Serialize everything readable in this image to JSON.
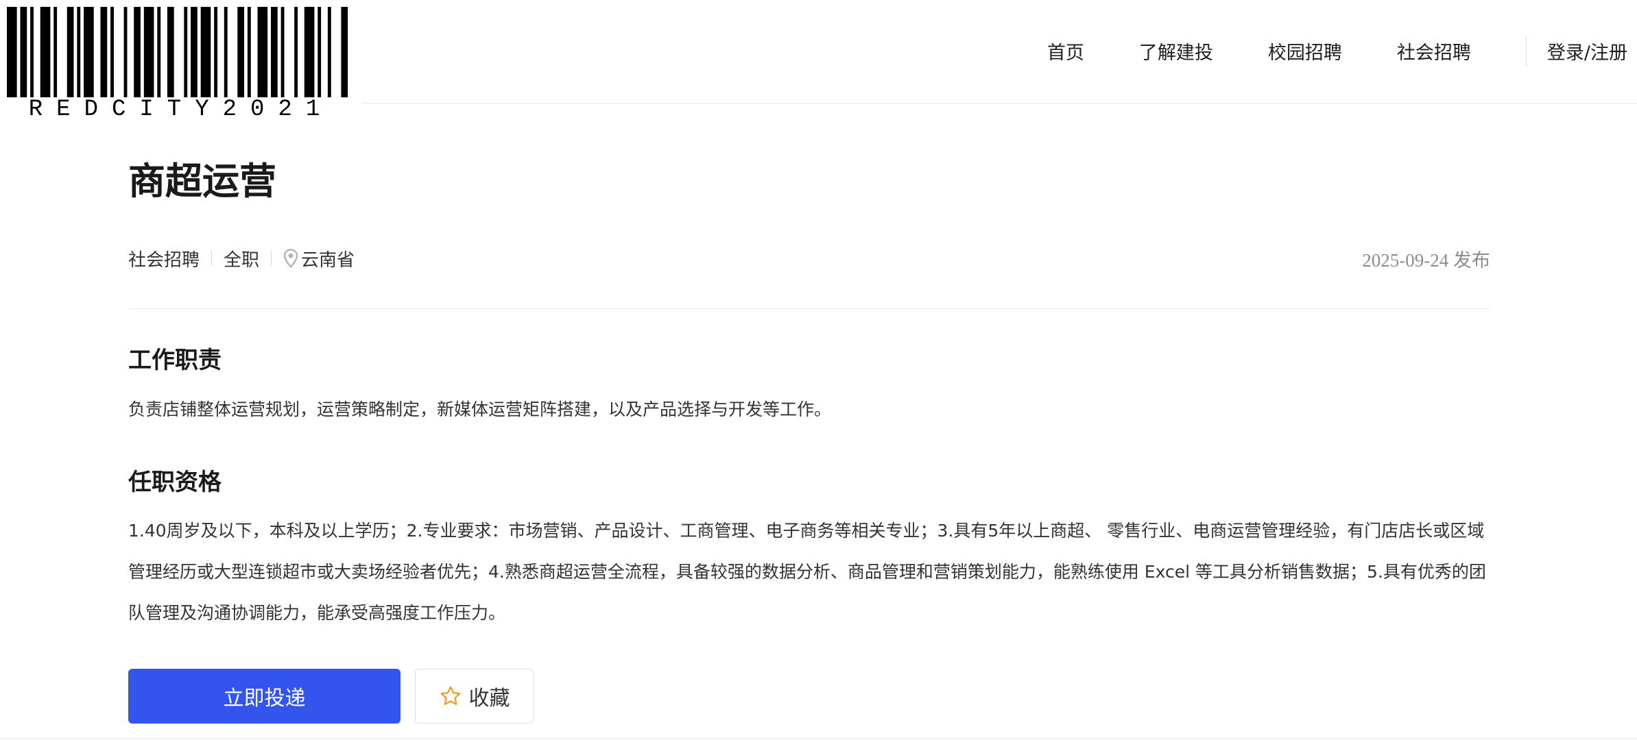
{
  "logo": {
    "barcode_text": "REDCITY2021"
  },
  "nav": {
    "home": "首页",
    "about": "了解建投",
    "campus": "校园招聘",
    "social": "社会招聘",
    "login": "登录/注册"
  },
  "job": {
    "title": "商超运营",
    "category": "社会招聘",
    "type": "全职",
    "location": "云南省",
    "published": "2025-09-24 发布"
  },
  "sections": {
    "duties_heading": "工作职责",
    "duties_text": "负责店铺整体运营规划，运营策略制定，新媒体运营矩阵搭建，以及产品选择与开发等工作。",
    "qualifications_heading": "任职资格",
    "qualifications_text": "1.40周岁及以下，本科及以上学历；2.专业要求：市场营销、产品设计、工商管理、电子商务等相关专业；3.具有5年以上商超、 零售行业、电商运营管理经验，有门店店长或区域管理经历或大型连锁超市或大卖场经验者优先；4.熟悉商超运营全流程，具备较强的数据分析、商品管理和营销策划能力，能熟练使用 Excel 等工具分析销售数据；5.具有优秀的团队管理及沟通协调能力，能承受高强度工作压力。"
  },
  "actions": {
    "apply": "立即投递",
    "favorite": "收藏"
  },
  "icons": {
    "location": "map-pin-icon",
    "favorite": "star-outline-icon"
  },
  "colors": {
    "primary": "#3355ee",
    "star": "#f59a23",
    "muted": "#8c8c8c"
  }
}
